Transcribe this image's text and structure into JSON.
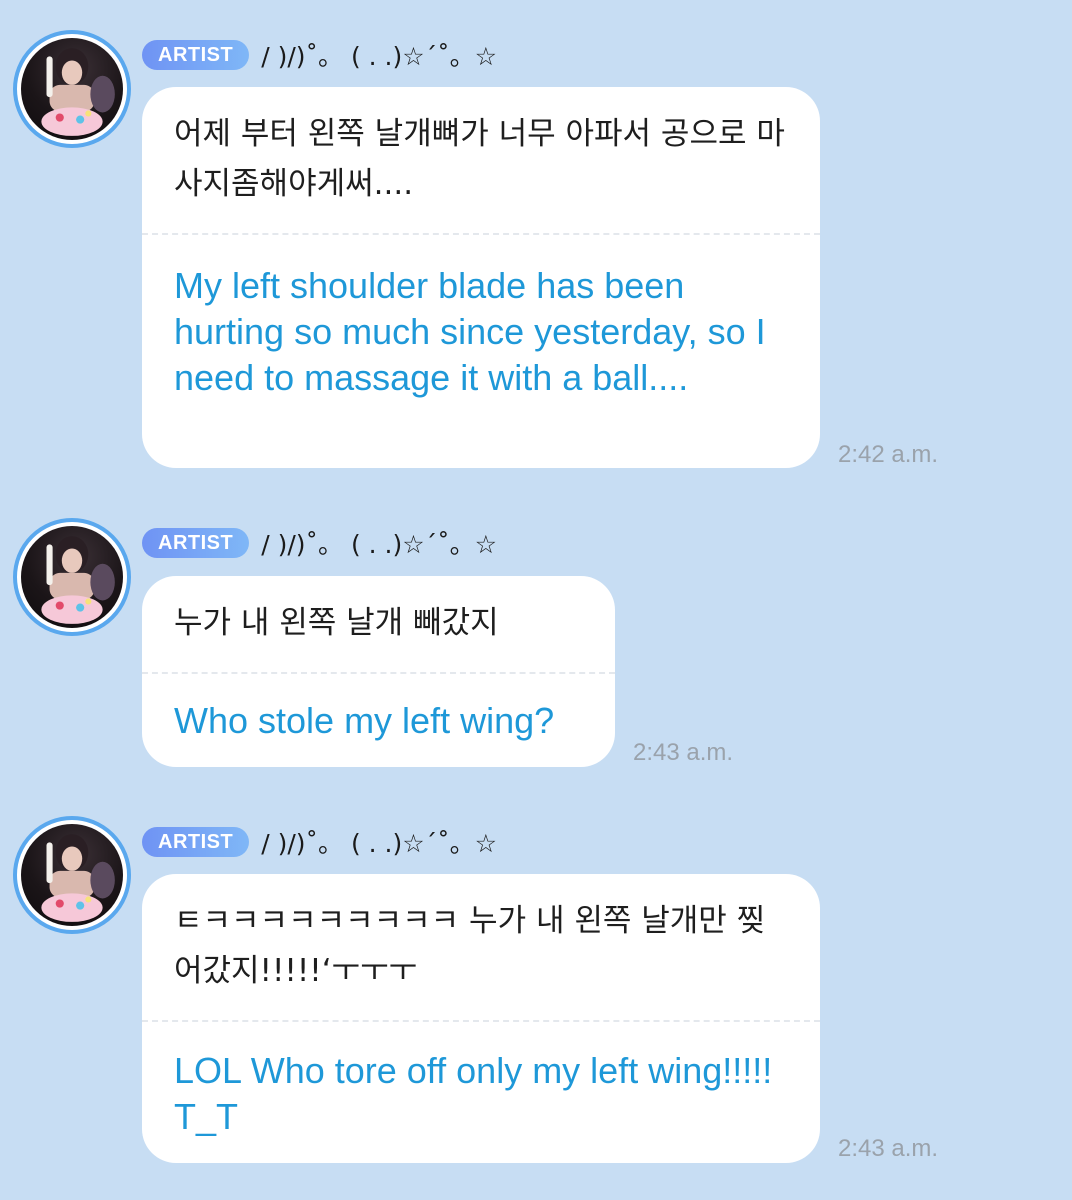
{
  "messages": [
    {
      "badge": "ARTIST",
      "name": "/ )/)˚。 ( . .)☆´˚。☆",
      "korean": "어제 부터 왼쪽 날개뼈가 너무 아파서 공으로 마사지좀해야게써....",
      "english": "My left shoulder blade has been hurting so much since yesterday, so I need to massage it with a ball....",
      "time": "2:42 a.m."
    },
    {
      "badge": "ARTIST",
      "name": "/ )/)˚。 ( . .)☆´˚。☆",
      "korean": "누가 내 왼쪽 날개 빼갔지",
      "english": "Who stole my left wing?",
      "time": "2:43 a.m."
    },
    {
      "badge": "ARTIST",
      "name": "/ )/)˚。 ( . .)☆´˚。☆",
      "korean": "ㅌㅋㅋㅋㅋㅋㅋㅋㅋㅋ 누가 내 왼쪽 날개만 찢어갔지!!!!!‘ㅜㅜㅜ",
      "english": "LOL Who tore off only my left wing!!!!! T_T",
      "time": "2:43 a.m."
    }
  ]
}
